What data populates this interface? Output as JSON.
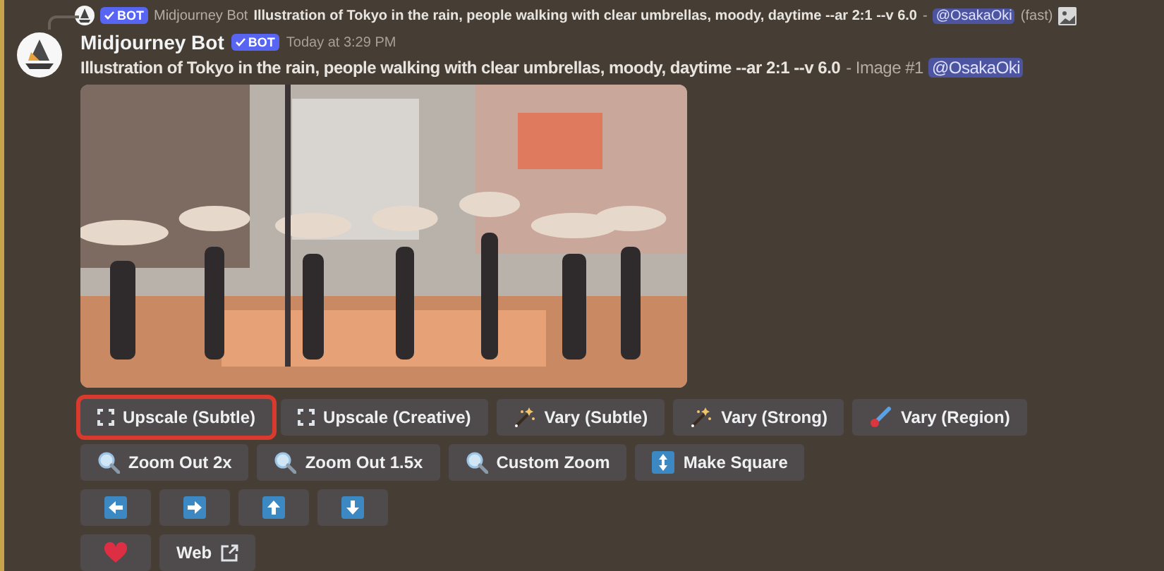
{
  "reply": {
    "bot_badge": "BOT",
    "author": "Midjourney Bot",
    "prompt": "Illustration of Tokyo in the rain, people walking with clear umbrellas, moody, daytime --ar 2:1 --v 6.0",
    "separator": "-",
    "mention": "@OsakaOki",
    "speed": "(fast)"
  },
  "message": {
    "mentioned": true,
    "author": "Midjourney Bot",
    "bot_badge": "BOT",
    "timestamp": "Today at 3:29 PM",
    "prompt": "Illustration of Tokyo in the rain, people walking with clear umbrellas, moody, daytime --ar 2:1 --v 6.0",
    "suffix": "- Image #1",
    "mention": "@OsakaOki"
  },
  "image": {
    "kind": "picture"
  },
  "button_rows": [
    [
      {
        "kind": "upscale",
        "label": "Upscale (Subtle)",
        "highlighted": true
      },
      {
        "kind": "upscale",
        "label": "Upscale (Creative)",
        "highlighted": false
      },
      {
        "kind": "sparkle",
        "label": "Vary (Subtle)",
        "highlighted": false
      },
      {
        "kind": "sparkle",
        "label": "Vary (Strong)",
        "highlighted": false
      },
      {
        "kind": "brush",
        "label": "Vary (Region)",
        "highlighted": false
      }
    ],
    [
      {
        "kind": "zoom",
        "label": "Zoom Out 2x",
        "highlighted": false
      },
      {
        "kind": "zoom",
        "label": "Zoom Out 1.5x",
        "highlighted": false
      },
      {
        "kind": "zoom",
        "label": "Custom Zoom",
        "highlighted": false
      },
      {
        "kind": "square",
        "label": "Make Square",
        "highlighted": false
      }
    ],
    [
      {
        "kind": "left",
        "highlighted": false
      },
      {
        "kind": "right",
        "highlighted": false
      },
      {
        "kind": "up",
        "highlighted": false
      },
      {
        "kind": "down",
        "highlighted": false
      }
    ],
    [
      {
        "kind": "heart",
        "highlighted": false
      },
      {
        "kind": "external",
        "label": "Web",
        "highlighted": false
      }
    ]
  ]
}
